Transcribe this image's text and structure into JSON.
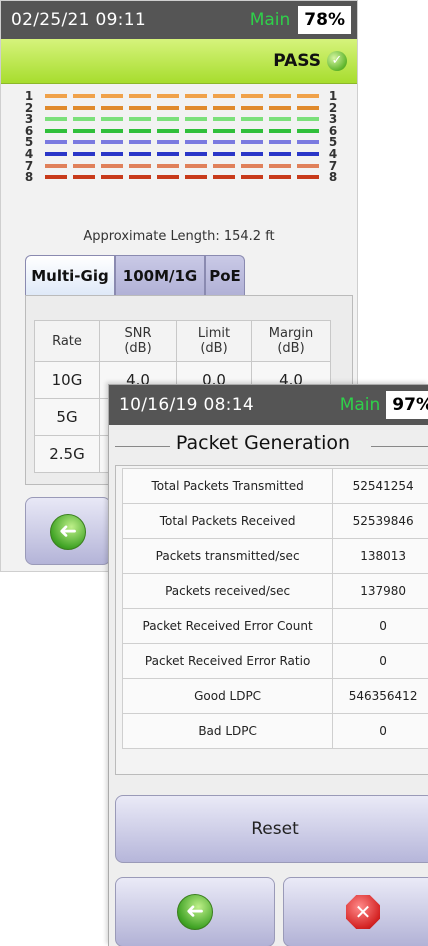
{
  "screen1": {
    "status": {
      "datetime": "02/25/21 09:11",
      "mode": "Main",
      "battery": "78%"
    },
    "result": "PASS",
    "wiremap": {
      "pins_left": [
        "1",
        "2",
        "3",
        "6",
        "5",
        "4",
        "7",
        "8"
      ],
      "pins_right": [
        "1",
        "2",
        "3",
        "6",
        "5",
        "4",
        "7",
        "8"
      ],
      "wire_colors": [
        "#f0a24a",
        "#e08a2c",
        "#7be07a",
        "#2fbf3a",
        "#7a7ae0",
        "#2a36c8",
        "#e0805a",
        "#c83a1a"
      ]
    },
    "approx_length": "Approximate Length: 154.2 ft",
    "tabs": [
      "Multi-Gig",
      "100M/1G",
      "PoE"
    ],
    "table": {
      "headers": [
        "Rate",
        "SNR\n(dB)",
        "Limit\n(dB)",
        "Margin\n(dB)"
      ],
      "rows": [
        [
          "10G",
          "4.0",
          "0.0",
          "4.0"
        ],
        [
          "5G",
          "",
          "",
          ""
        ],
        [
          "2.5G",
          "",
          "",
          ""
        ]
      ]
    },
    "back_icon": "back-arrow-icon"
  },
  "screen2": {
    "status": {
      "datetime": "10/16/19 08:14",
      "mode": "Main",
      "battery": "97%"
    },
    "title": "Packet Generation",
    "stats": [
      {
        "label": "Total Packets Transmitted",
        "value": "52541254"
      },
      {
        "label": "Total Packets Received",
        "value": "52539846"
      },
      {
        "label": "Packets transmitted/sec",
        "value": "138013"
      },
      {
        "label": "Packets received/sec",
        "value": "137980"
      },
      {
        "label": "Packet Received Error Count",
        "value": "0"
      },
      {
        "label": "Packet Received Error Ratio",
        "value": "0"
      },
      {
        "label": "Good LDPC",
        "value": "546356412"
      },
      {
        "label": "Bad LDPC",
        "value": "0"
      }
    ],
    "reset_label": "Reset",
    "back_icon": "back-arrow-icon",
    "close_icon": "close-stop-icon"
  }
}
